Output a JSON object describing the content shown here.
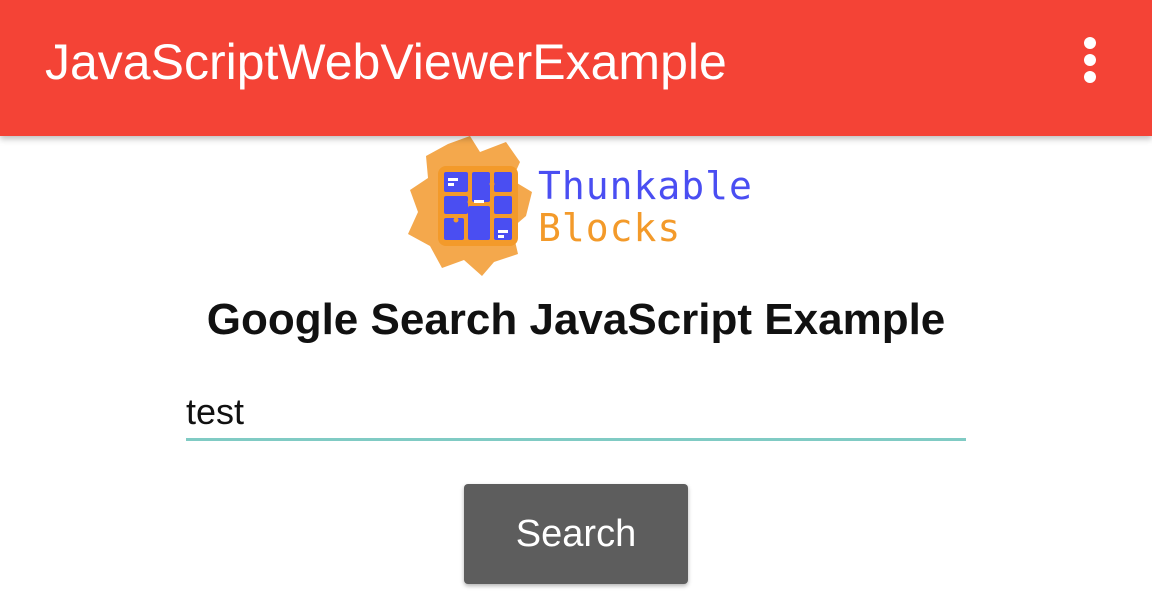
{
  "app_bar": {
    "title": "JavaScriptWebViewerExample",
    "background_color": "#f44336",
    "overflow_icon": "more-vert-icon"
  },
  "logo": {
    "line1": "Thunkable",
    "line2": "Blocks",
    "line1_color": "#4a4ef2",
    "line2_color": "#f39a2a",
    "icon": "thunkable-blocks-logo-icon"
  },
  "main": {
    "heading": "Google Search JavaScript Example",
    "search_input_value": "test",
    "search_button_label": "Search",
    "input_underline_color": "#80cbc4",
    "button_color": "#5d5d5d"
  }
}
